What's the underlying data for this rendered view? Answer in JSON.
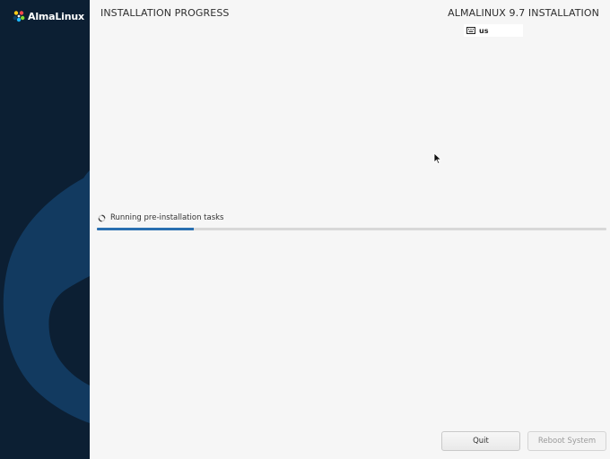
{
  "sidebar": {
    "logo_text": "AlmaLinux",
    "background_color": "#0c1f33",
    "art_color": "#123a60"
  },
  "header": {
    "page_title": "INSTALLATION PROGRESS",
    "product_title": "ALMALINUX 9.7 INSTALLATION",
    "keyboard_layout": "us",
    "keyboard_icon": "keyboard-icon"
  },
  "progress": {
    "status_text": "Running pre-installation tasks",
    "spinner_icon": "spinner-icon",
    "percent": 19,
    "fill_color": "#2a6fb0"
  },
  "footer": {
    "quit_label": "Quit",
    "reboot_label": "Reboot System"
  }
}
